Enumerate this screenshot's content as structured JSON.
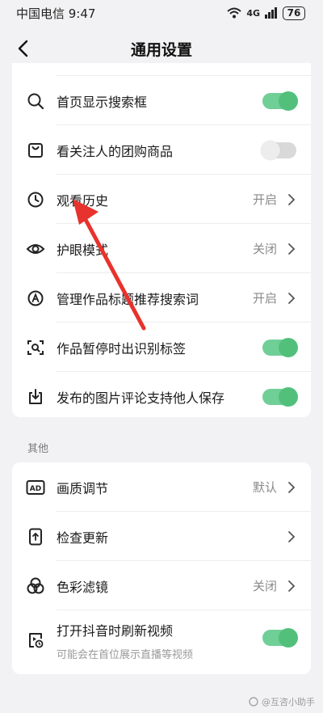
{
  "status": {
    "carrier_time": "中国电信 9:47",
    "network": "4G",
    "battery": "76"
  },
  "header": {
    "title": "通用设置"
  },
  "group1": {
    "items": [
      {
        "label": "首页显示搜索框",
        "icon": "search-icon",
        "toggle": "on"
      },
      {
        "label": "看关注人的团购商品",
        "icon": "bag-icon",
        "toggle": "off"
      },
      {
        "label": "观看历史",
        "icon": "clock-icon",
        "value": "开启"
      },
      {
        "label": "护眼模式",
        "icon": "eye-icon",
        "value": "关闭"
      },
      {
        "label": "管理作品标题推荐搜索词",
        "icon": "search-badge-icon",
        "value": "开启"
      },
      {
        "label": "作品暂停时出识别标签",
        "icon": "scan-icon",
        "toggle": "on"
      },
      {
        "label": "发布的图片评论支持他人保存",
        "icon": "download-icon",
        "toggle": "on"
      }
    ]
  },
  "group2": {
    "title": "其他",
    "items": [
      {
        "label": "画质调节",
        "icon": "ad-icon",
        "value": "默认"
      },
      {
        "label": "检查更新",
        "icon": "phone-update-icon"
      },
      {
        "label": "色彩滤镜",
        "icon": "color-filter-icon",
        "value": "关闭"
      },
      {
        "label": "打开抖音时刷新视频",
        "sublabel": "可能会在首位展示直播等视频",
        "icon": "refresh-video-icon",
        "toggle": "on"
      }
    ]
  },
  "colors": {
    "toggle_on": "#52c07b",
    "arrow": "#e8322d"
  },
  "watermark": "@互咨小助手"
}
